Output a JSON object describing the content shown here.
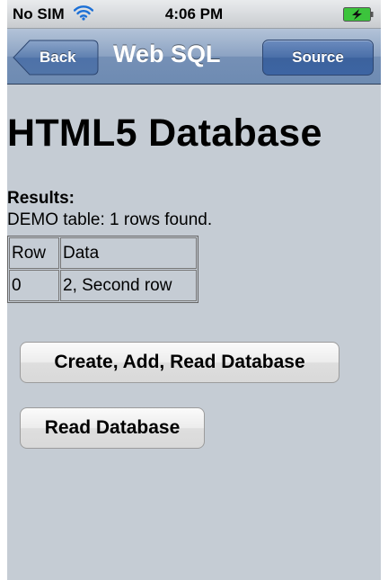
{
  "status_bar": {
    "carrier": "No SIM",
    "time": "4:06 PM"
  },
  "nav_bar": {
    "back_label": "Back",
    "title": "Web SQL",
    "source_label": "Source"
  },
  "content": {
    "heading": "HTML5 Database",
    "results_label": "Results:",
    "summary": "DEMO table: 1 rows found.",
    "table": {
      "headers": [
        "Row",
        "Data"
      ],
      "rows": [
        [
          "0",
          "2, Second row"
        ]
      ]
    },
    "buttons": {
      "create_label": "Create, Add, Read Database",
      "read_label": "Read Database"
    }
  },
  "colors": {
    "background": "#c5ccd4",
    "nav_bar": "#6e8bb2",
    "battery_charge": "#3cc43c"
  },
  "icons": [
    "wifi-icon",
    "battery-charging-icon",
    "back-arrow-icon"
  ]
}
